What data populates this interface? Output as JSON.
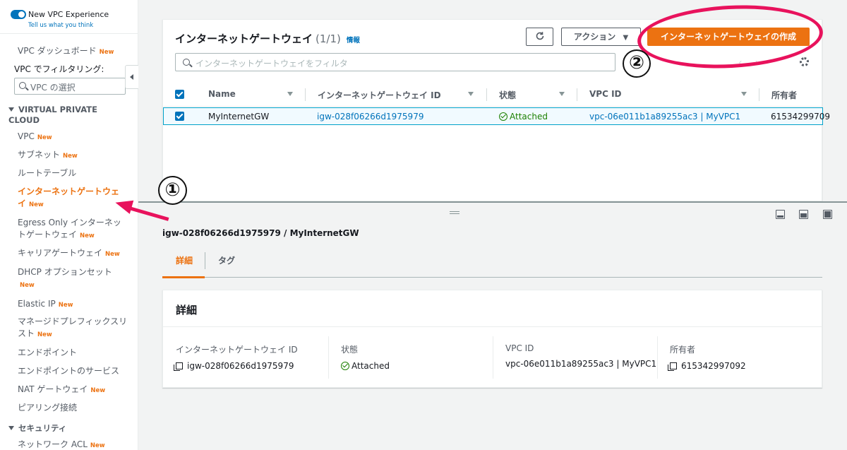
{
  "sidebar": {
    "experience_title": "New VPC Experience",
    "experience_link": "Tell us what you think",
    "dashboard": "VPC ダッシュボード",
    "filter_label": "VPC でフィルタリング:",
    "vpc_select_placeholder": "VPC の選択",
    "section_vpc": "VIRTUAL PRIVATE CLOUD",
    "items": [
      {
        "label": "VPC",
        "new": "New"
      },
      {
        "label": "サブネット",
        "new": "New"
      },
      {
        "label": "ルートテーブル",
        "new": ""
      },
      {
        "label": "インターネットゲートウェイ",
        "new": "New"
      },
      {
        "label": "Egress Only インターネットゲートウェイ",
        "new": "New"
      },
      {
        "label": "キャリアゲートウェイ",
        "new": "New"
      },
      {
        "label": "DHCP オプションセット",
        "new": "New"
      },
      {
        "label": "Elastic IP",
        "new": "New"
      },
      {
        "label": "マネージドプレフィックスリスト",
        "new": "New"
      },
      {
        "label": "エンドポイント",
        "new": ""
      },
      {
        "label": "エンドポイントのサービス",
        "new": ""
      },
      {
        "label": "NAT ゲートウェイ",
        "new": "New"
      },
      {
        "label": "ピアリング接続",
        "new": ""
      }
    ],
    "section_security": "セキュリティ",
    "security_items": [
      {
        "label": "ネットワーク ACL",
        "new": "New"
      }
    ],
    "dashboard_new": "New"
  },
  "main": {
    "title": "インターネットゲートウェイ",
    "count": "(1/1)",
    "info": "情報",
    "actions_label": "アクション",
    "create_label": "インターネットゲートウェイの作成",
    "filter_placeholder": "インターネットゲートウェイをフィルタ",
    "columns": [
      "Name",
      "インターネットゲートウェイ ID",
      "状態",
      "VPC ID",
      "所有者"
    ],
    "row": {
      "name": "MyInternetGW",
      "id": "igw-028f06266d1975979",
      "state": "Attached",
      "vpc": "vpc-06e011b1a89255ac3 | MyVPC1",
      "owner": "61534299709"
    }
  },
  "detail": {
    "title": "igw-028f06266d1975979 / MyInternetGW",
    "tabs": [
      "詳細",
      "タグ"
    ],
    "card_title": "詳細",
    "fields": [
      {
        "label": "インターネットゲートウェイ ID",
        "value": "igw-028f06266d1975979"
      },
      {
        "label": "状態",
        "value": "Attached"
      },
      {
        "label": "VPC ID",
        "value": "vpc-06e011b1a89255ac3 | MyVPC1"
      },
      {
        "label": "所有者",
        "value": "615342997092"
      }
    ]
  },
  "annotations": {
    "step1": "①",
    "step2": "②"
  },
  "colors": {
    "accent": "#ec7211",
    "link": "#0073bb",
    "ok": "#1d8102",
    "highlight": "#e8125c"
  }
}
